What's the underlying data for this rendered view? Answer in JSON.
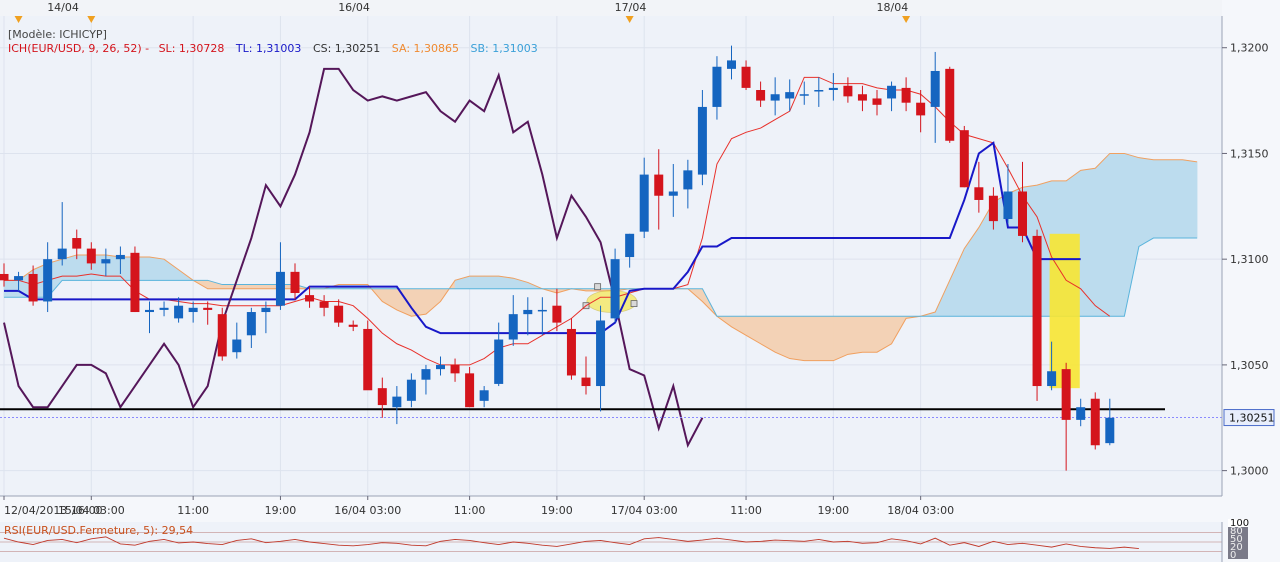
{
  "legend": {
    "model": "[Modèle: ICHICYP]",
    "ich_prefix": "ICH(EUR/USD, 9, 26, 52) -",
    "sl": "SL: 1,30728",
    "tl": "TL: 1,31003",
    "cs": "CS: 1,30251",
    "sa": "SA: 1,30865",
    "sb": "SB: 1,31003"
  },
  "rsi_label": "RSI(EUR/USD.Fermeture, 5): 29,54",
  "rsi_scale": [
    "100",
    "80",
    "50",
    "20",
    "0"
  ],
  "top_dates": [
    {
      "label": "14/04",
      "slot": 4
    },
    {
      "label": "16/04",
      "slot": 24
    },
    {
      "label": "17/04",
      "slot": 43
    },
    {
      "label": "18/04",
      "slot": 61
    }
  ],
  "top_markers": [
    1,
    6,
    43,
    62
  ],
  "x_ticks": [
    {
      "label": "12/04/2013 16:00",
      "slot": 0
    },
    {
      "label": "15/04 03:00",
      "slot": 6
    },
    {
      "label": "11:00",
      "slot": 13
    },
    {
      "label": "19:00",
      "slot": 19
    },
    {
      "label": "16/04 03:00",
      "slot": 25
    },
    {
      "label": "11:00",
      "slot": 32
    },
    {
      "label": "19:00",
      "slot": 38
    },
    {
      "label": "17/04 03:00",
      "slot": 44
    },
    {
      "label": "11:00",
      "slot": 51
    },
    {
      "label": "19:00",
      "slot": 57
    },
    {
      "label": "18/04 03:00",
      "slot": 63
    }
  ],
  "price_label": "1,30251",
  "colors": {
    "up": "#1565c0",
    "down": "#d4141c",
    "tenkan": "#1818c8",
    "kijun": "#e8302a",
    "chikou": "#55175a",
    "spanA": "#f0a060",
    "spanB": "#5ab4dc",
    "cloud_bull": "#bcdcee",
    "cloud_bear": "#f3d2b6",
    "support": "#000000",
    "highlight": "#f7e632"
  },
  "chart_data": {
    "type": "candlestick",
    "instrument": "EUR/USD",
    "ylim": [
      1.2988,
      1.3215
    ],
    "yticks": [
      "1,3000",
      "1,3050",
      "1,3100",
      "1,3150",
      "1,3200"
    ],
    "ytick_values": [
      1.3,
      1.305,
      1.31,
      1.315,
      1.32
    ],
    "candles": [
      {
        "o": 1.3093,
        "h": 1.3098,
        "l": 1.3087,
        "c": 1.309
      },
      {
        "o": 1.309,
        "h": 1.3094,
        "l": 1.3085,
        "c": 1.3092
      },
      {
        "o": 1.3093,
        "h": 1.3097,
        "l": 1.3078,
        "c": 1.308
      },
      {
        "o": 1.308,
        "h": 1.3108,
        "l": 1.3075,
        "c": 1.31
      },
      {
        "o": 1.31,
        "h": 1.3127,
        "l": 1.3097,
        "c": 1.3105
      },
      {
        "o": 1.311,
        "h": 1.3114,
        "l": 1.31,
        "c": 1.3105
      },
      {
        "o": 1.3105,
        "h": 1.3108,
        "l": 1.3095,
        "c": 1.3098
      },
      {
        "o": 1.3098,
        "h": 1.3105,
        "l": 1.3092,
        "c": 1.31
      },
      {
        "o": 1.31,
        "h": 1.3106,
        "l": 1.3093,
        "c": 1.3102
      },
      {
        "o": 1.3103,
        "h": 1.3106,
        "l": 1.3075,
        "c": 1.3075
      },
      {
        "o": 1.3075,
        "h": 1.308,
        "l": 1.3065,
        "c": 1.3076
      },
      {
        "o": 1.3076,
        "h": 1.308,
        "l": 1.3073,
        "c": 1.3077
      },
      {
        "o": 1.3072,
        "h": 1.3082,
        "l": 1.307,
        "c": 1.3078
      },
      {
        "o": 1.3075,
        "h": 1.308,
        "l": 1.307,
        "c": 1.3077
      },
      {
        "o": 1.3077,
        "h": 1.308,
        "l": 1.3069,
        "c": 1.3076
      },
      {
        "o": 1.3074,
        "h": 1.3077,
        "l": 1.3052,
        "c": 1.3054
      },
      {
        "o": 1.3056,
        "h": 1.307,
        "l": 1.3053,
        "c": 1.3062
      },
      {
        "o": 1.3064,
        "h": 1.3077,
        "l": 1.3058,
        "c": 1.3075
      },
      {
        "o": 1.3075,
        "h": 1.308,
        "l": 1.3065,
        "c": 1.3077
      },
      {
        "o": 1.3078,
        "h": 1.3108,
        "l": 1.3076,
        "c": 1.3094
      },
      {
        "o": 1.3094,
        "h": 1.3098,
        "l": 1.3081,
        "c": 1.3084
      },
      {
        "o": 1.3083,
        "h": 1.3087,
        "l": 1.3077,
        "c": 1.308
      },
      {
        "o": 1.308,
        "h": 1.3083,
        "l": 1.3073,
        "c": 1.3077
      },
      {
        "o": 1.3078,
        "h": 1.3081,
        "l": 1.3068,
        "c": 1.307
      },
      {
        "o": 1.3069,
        "h": 1.3071,
        "l": 1.3066,
        "c": 1.3068
      },
      {
        "o": 1.3067,
        "h": 1.3071,
        "l": 1.304,
        "c": 1.3038
      },
      {
        "o": 1.3039,
        "h": 1.3044,
        "l": 1.3025,
        "c": 1.3031
      },
      {
        "o": 1.303,
        "h": 1.304,
        "l": 1.3022,
        "c": 1.3035
      },
      {
        "o": 1.3033,
        "h": 1.3046,
        "l": 1.303,
        "c": 1.3043
      },
      {
        "o": 1.3043,
        "h": 1.305,
        "l": 1.3036,
        "c": 1.3048
      },
      {
        "o": 1.3048,
        "h": 1.3054,
        "l": 1.3045,
        "c": 1.305
      },
      {
        "o": 1.305,
        "h": 1.3053,
        "l": 1.3042,
        "c": 1.3046
      },
      {
        "o": 1.3046,
        "h": 1.3049,
        "l": 1.303,
        "c": 1.303
      },
      {
        "o": 1.3033,
        "h": 1.304,
        "l": 1.303,
        "c": 1.3038
      },
      {
        "o": 1.3041,
        "h": 1.307,
        "l": 1.304,
        "c": 1.3062
      },
      {
        "o": 1.3062,
        "h": 1.3083,
        "l": 1.3059,
        "c": 1.3074
      },
      {
        "o": 1.3074,
        "h": 1.3082,
        "l": 1.3064,
        "c": 1.3076
      },
      {
        "o": 1.3076,
        "h": 1.3082,
        "l": 1.3064,
        "c": 1.3076
      },
      {
        "o": 1.3078,
        "h": 1.3086,
        "l": 1.3066,
        "c": 1.307
      },
      {
        "o": 1.3067,
        "h": 1.3072,
        "l": 1.3043,
        "c": 1.3045
      },
      {
        "o": 1.3044,
        "h": 1.3054,
        "l": 1.3036,
        "c": 1.304
      },
      {
        "o": 1.304,
        "h": 1.3078,
        "l": 1.3028,
        "c": 1.3071
      },
      {
        "o": 1.3072,
        "h": 1.3105,
        "l": 1.307,
        "c": 1.31
      },
      {
        "o": 1.3101,
        "h": 1.3112,
        "l": 1.3096,
        "c": 1.3112
      },
      {
        "o": 1.3113,
        "h": 1.3148,
        "l": 1.311,
        "c": 1.314
      },
      {
        "o": 1.314,
        "h": 1.3152,
        "l": 1.3114,
        "c": 1.313
      },
      {
        "o": 1.313,
        "h": 1.3145,
        "l": 1.312,
        "c": 1.3132
      },
      {
        "o": 1.3133,
        "h": 1.3147,
        "l": 1.3124,
        "c": 1.3142
      },
      {
        "o": 1.314,
        "h": 1.318,
        "l": 1.3135,
        "c": 1.3172
      },
      {
        "o": 1.3172,
        "h": 1.3196,
        "l": 1.3166,
        "c": 1.3191
      },
      {
        "o": 1.319,
        "h": 1.3201,
        "l": 1.3185,
        "c": 1.3194
      },
      {
        "o": 1.3191,
        "h": 1.3194,
        "l": 1.318,
        "c": 1.3181
      },
      {
        "o": 1.318,
        "h": 1.3184,
        "l": 1.3172,
        "c": 1.3175
      },
      {
        "o": 1.3175,
        "h": 1.3186,
        "l": 1.3168,
        "c": 1.3178
      },
      {
        "o": 1.3176,
        "h": 1.3185,
        "l": 1.317,
        "c": 1.3179
      },
      {
        "o": 1.3178,
        "h": 1.3184,
        "l": 1.3173,
        "c": 1.3178
      },
      {
        "o": 1.318,
        "h": 1.3186,
        "l": 1.3172,
        "c": 1.318
      },
      {
        "o": 1.318,
        "h": 1.3188,
        "l": 1.3175,
        "c": 1.3181
      },
      {
        "o": 1.3182,
        "h": 1.3186,
        "l": 1.3174,
        "c": 1.3177
      },
      {
        "o": 1.3178,
        "h": 1.3182,
        "l": 1.317,
        "c": 1.3175
      },
      {
        "o": 1.3176,
        "h": 1.318,
        "l": 1.3168,
        "c": 1.3173
      },
      {
        "o": 1.3176,
        "h": 1.3184,
        "l": 1.317,
        "c": 1.3182
      },
      {
        "o": 1.3181,
        "h": 1.3186,
        "l": 1.317,
        "c": 1.3174
      },
      {
        "o": 1.3174,
        "h": 1.318,
        "l": 1.316,
        "c": 1.3168
      },
      {
        "o": 1.3172,
        "h": 1.3198,
        "l": 1.3155,
        "c": 1.3189
      },
      {
        "o": 1.319,
        "h": 1.3191,
        "l": 1.3155,
        "c": 1.3156
      },
      {
        "o": 1.3161,
        "h": 1.3163,
        "l": 1.3134,
        "c": 1.3134
      },
      {
        "o": 1.3134,
        "h": 1.3146,
        "l": 1.3122,
        "c": 1.3128
      },
      {
        "o": 1.313,
        "h": 1.3134,
        "l": 1.3114,
        "c": 1.3118
      },
      {
        "o": 1.3119,
        "h": 1.3145,
        "l": 1.3117,
        "c": 1.3132
      },
      {
        "o": 1.3132,
        "h": 1.3146,
        "l": 1.3108,
        "c": 1.3111
      },
      {
        "o": 1.3111,
        "h": 1.3114,
        "l": 1.3033,
        "c": 1.304
      },
      {
        "o": 1.304,
        "h": 1.3061,
        "l": 1.3038,
        "c": 1.3047
      },
      {
        "o": 1.3048,
        "h": 1.3051,
        "l": 1.3,
        "c": 1.3024
      },
      {
        "o": 1.3024,
        "h": 1.3034,
        "l": 1.3021,
        "c": 1.303
      },
      {
        "o": 1.3034,
        "h": 1.3037,
        "l": 1.301,
        "c": 1.3012
      },
      {
        "o": 1.3013,
        "h": 1.3034,
        "l": 1.3012,
        "c": 1.3025
      }
    ],
    "tenkan": [
      1.3085,
      1.3085,
      1.3081,
      1.3081,
      1.3081,
      1.3081,
      1.3081,
      1.3081,
      1.3081,
      1.3081,
      1.3081,
      1.3081,
      1.3081,
      1.3081,
      1.3081,
      1.3081,
      1.3081,
      1.3081,
      1.3081,
      1.3081,
      1.3081,
      1.3087,
      1.3087,
      1.3087,
      1.3087,
      1.3087,
      1.3087,
      1.3087,
      1.3077,
      1.3068,
      1.3065,
      1.3065,
      1.3065,
      1.3065,
      1.3065,
      1.3065,
      1.3065,
      1.3065,
      1.3065,
      1.3065,
      1.3065,
      1.3065,
      1.307,
      1.3085,
      1.3086,
      1.3086,
      1.3086,
      1.3094,
      1.3106,
      1.3106,
      1.311,
      1.311,
      1.311,
      1.311,
      1.311,
      1.311,
      1.311,
      1.311,
      1.311,
      1.311,
      1.311,
      1.311,
      1.311,
      1.311,
      1.311,
      1.311,
      1.3128,
      1.315,
      1.3155,
      1.3115,
      1.3115,
      1.31,
      1.31,
      1.31,
      1.31
    ],
    "kijun": [
      1.309,
      1.309,
      1.3088,
      1.309,
      1.3092,
      1.3092,
      1.3093,
      1.3092,
      1.3092,
      1.3085,
      1.3081,
      1.3081,
      1.308,
      1.3079,
      1.3079,
      1.3078,
      1.3078,
      1.3078,
      1.3078,
      1.3078,
      1.308,
      1.3082,
      1.308,
      1.308,
      1.3078,
      1.3072,
      1.3065,
      1.306,
      1.3057,
      1.3053,
      1.305,
      1.305,
      1.305,
      1.3053,
      1.3058,
      1.306,
      1.306,
      1.3064,
      1.3068,
      1.3072,
      1.3078,
      1.3082,
      1.3082,
      1.3084,
      1.3086,
      1.3086,
      1.3086,
      1.3088,
      1.311,
      1.3145,
      1.3157,
      1.316,
      1.3162,
      1.3166,
      1.317,
      1.3186,
      1.3186,
      1.3183,
      1.3183,
      1.3183,
      1.3181,
      1.318,
      1.318,
      1.3178,
      1.3172,
      1.3165,
      1.3159,
      1.3157,
      1.3155,
      1.3143,
      1.313,
      1.312,
      1.3101,
      1.309,
      1.3086,
      1.3078,
      1.3073
    ],
    "chikou": [
      1.307,
      1.304,
      1.303,
      1.303,
      1.304,
      1.305,
      1.305,
      1.3046,
      1.303,
      1.304,
      1.305,
      1.306,
      1.305,
      1.303,
      1.304,
      1.307,
      1.309,
      1.311,
      1.3135,
      1.3125,
      1.314,
      1.316,
      1.319,
      1.319,
      1.318,
      1.3175,
      1.3177,
      1.3175,
      1.3177,
      1.3179,
      1.317,
      1.3165,
      1.3175,
      1.317,
      1.3187,
      1.316,
      1.3165,
      1.314,
      1.311,
      1.313,
      1.312,
      1.3108,
      1.308,
      1.3048,
      1.3045,
      1.302,
      1.304,
      1.3012,
      1.3025
    ],
    "span_a": [
      1.309,
      1.309,
      1.3095,
      1.3098,
      1.31,
      1.3102,
      1.3102,
      1.3102,
      1.3101,
      1.3101,
      1.3101,
      1.31,
      1.3095,
      1.309,
      1.3086,
      1.3086,
      1.3086,
      1.3086,
      1.3086,
      1.3086,
      1.3086,
      1.3086,
      1.3086,
      1.3088,
      1.3088,
      1.3088,
      1.308,
      1.3076,
      1.3073,
      1.3074,
      1.308,
      1.309,
      1.3092,
      1.3092,
      1.3092,
      1.3091,
      1.3089,
      1.3086,
      1.3084,
      1.3086,
      1.3085,
      1.3085,
      1.3085,
      1.3086,
      1.3086,
      1.3086,
      1.3086,
      1.3086,
      1.308,
      1.3073,
      1.3068,
      1.3064,
      1.306,
      1.3056,
      1.3053,
      1.3052,
      1.3052,
      1.3052,
      1.3055,
      1.3056,
      1.3056,
      1.306,
      1.3072,
      1.3073,
      1.3075,
      1.309,
      1.3105,
      1.3115,
      1.3127,
      1.3131,
      1.3134,
      1.3135,
      1.3137,
      1.3137,
      1.3142,
      1.3143,
      1.315,
      1.315,
      1.3148,
      1.3147,
      1.3147,
      1.3147,
      1.3146
    ],
    "span_b": [
      1.3082,
      1.3082,
      1.3082,
      1.3082,
      1.309,
      1.309,
      1.309,
      1.309,
      1.309,
      1.309,
      1.309,
      1.309,
      1.309,
      1.309,
      1.309,
      1.3088,
      1.3088,
      1.3088,
      1.3088,
      1.3088,
      1.3088,
      1.3086,
      1.3086,
      1.3086,
      1.3086,
      1.3086,
      1.3086,
      1.3086,
      1.3086,
      1.3086,
      1.3086,
      1.3086,
      1.3086,
      1.3086,
      1.3086,
      1.3086,
      1.3086,
      1.3086,
      1.3086,
      1.3086,
      1.3086,
      1.3086,
      1.3086,
      1.3086,
      1.3086,
      1.3086,
      1.3086,
      1.3086,
      1.3086,
      1.3073,
      1.3073,
      1.3073,
      1.3073,
      1.3073,
      1.3073,
      1.3073,
      1.3073,
      1.3073,
      1.3073,
      1.3073,
      1.3073,
      1.3073,
      1.3073,
      1.3073,
      1.3073,
      1.3073,
      1.3073,
      1.3073,
      1.3073,
      1.3073,
      1.3073,
      1.3073,
      1.3073,
      1.3073,
      1.3073,
      1.3073,
      1.3073,
      1.3073,
      1.3106,
      1.311,
      1.311,
      1.311,
      1.311
    ],
    "support_level": 1.3029,
    "current_price": 1.30251,
    "rsi": {
      "period": 5,
      "last": 29.54,
      "ylim": [
        0,
        100
      ],
      "values": [
        62,
        50,
        42,
        55,
        58,
        48,
        60,
        66,
        44,
        40,
        52,
        58,
        47,
        50,
        45,
        42,
        55,
        60,
        48,
        52,
        58,
        50,
        45,
        40,
        38,
        42,
        48,
        46,
        40,
        38,
        52,
        58,
        55,
        48,
        42,
        50,
        46,
        40,
        36,
        44,
        52,
        55,
        48,
        42,
        60,
        64,
        58,
        52,
        56,
        62,
        56,
        50,
        52,
        56,
        54,
        52,
        58,
        50,
        52,
        46,
        48,
        60,
        54,
        44,
        62,
        40,
        48,
        36,
        52,
        42,
        46,
        40,
        34,
        44,
        36,
        32,
        30,
        34,
        29.54
      ]
    },
    "annotations": [
      {
        "type": "ellipse",
        "around": "kumo twist",
        "slots": [
          40.2,
          42.8
        ]
      },
      {
        "type": "highlight_box",
        "slots": [
          72.0,
          73.8
        ]
      }
    ]
  }
}
